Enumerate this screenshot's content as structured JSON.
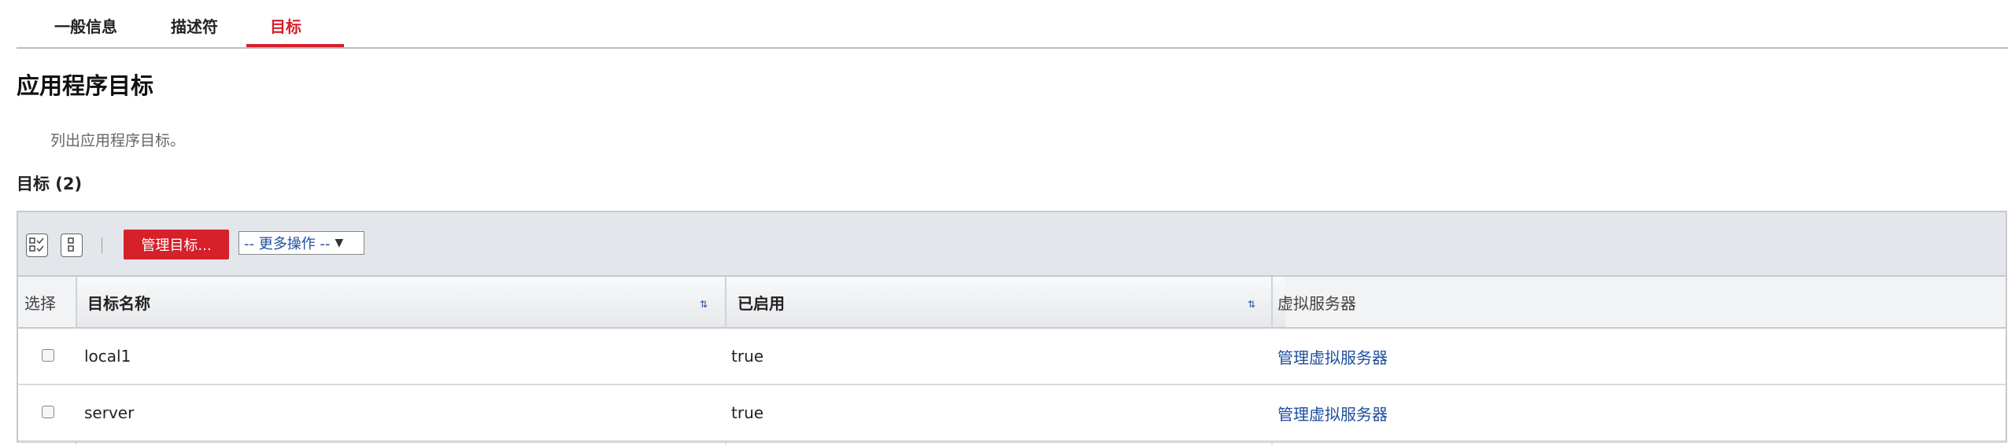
{
  "tabs": [
    {
      "label": "一般信息",
      "active": false
    },
    {
      "label": "描述符",
      "active": false
    },
    {
      "label": "目标",
      "active": true
    }
  ],
  "page_title": "应用程序目标",
  "description": "列出应用程序目标。",
  "section_title": "目标 (2)",
  "toolbar": {
    "select_all_icon": "select-all-icon",
    "deselect_icon": "deselect-all-icon",
    "manage_button": "管理目标...",
    "more_actions": "-- 更多操作 --"
  },
  "table": {
    "columns": [
      "选择",
      "目标名称",
      "已启用",
      "虚拟服务器"
    ],
    "rows": [
      {
        "name": "local1",
        "enabled": "true",
        "virtual_server": "管理虚拟服务器"
      },
      {
        "name": "server",
        "enabled": "true",
        "virtual_server": "管理虚拟服务器"
      }
    ]
  },
  "colors": {
    "accent": "#d6202a",
    "link": "#1f4e9e",
    "toolbar_bg": "#e3e6ea"
  }
}
